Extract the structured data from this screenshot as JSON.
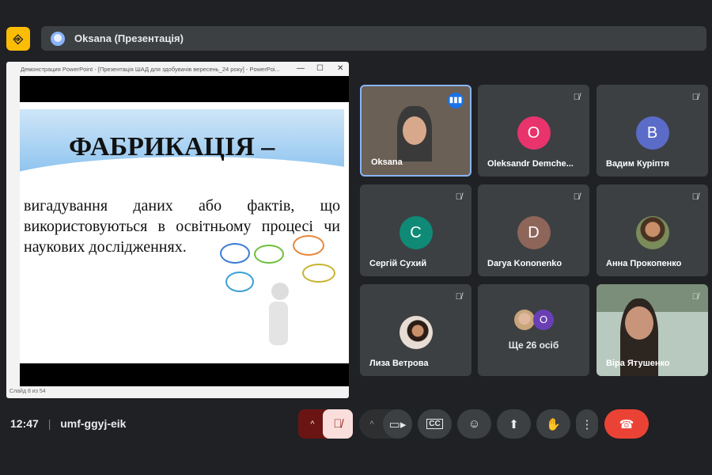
{
  "app_icon": "exit-icon",
  "top_bar": {
    "presenter": "Oksana (Презентація)"
  },
  "presentation": {
    "window_title": "Демонстрация PowerPoint - [Презентація ШАД для здобувачів вересень_24 року] - PowerPoi...",
    "slide_title": "ФАБРИКАЦІЯ –",
    "slide_text": "вигадування даних або фактів, що використовуються в освітньому процесі чи наукових дослідженнях.",
    "status": "Слайд 8 из 54"
  },
  "participants": [
    {
      "name": "Oksana",
      "type": "video",
      "speaking": true
    },
    {
      "name": "Oleksandr Demche...",
      "initial": "O",
      "color": "#e8336d",
      "muted": true
    },
    {
      "name": "Вадим Курiптя",
      "initial": "B",
      "color": "#5b6bc8",
      "muted": true
    },
    {
      "name": "Сергій Сухий",
      "initial": "C",
      "color": "#0f8a76",
      "muted": true
    },
    {
      "name": "Darya Kononenko",
      "initial": "D",
      "color": "#8d6659",
      "muted": true
    },
    {
      "name": "Анна Прокопенко",
      "type": "photo",
      "muted": true
    },
    {
      "name": "Лиза Ветрова",
      "type": "photo",
      "muted": true
    },
    {
      "name": "Ще 26 осіб",
      "type": "more",
      "initial": "O",
      "color": "#6a3fb5"
    },
    {
      "name": "Віра Ятушенко",
      "type": "video",
      "muted": true
    }
  ],
  "bottom": {
    "time": "12:47",
    "meeting_code": "umf-ggyj-eik"
  },
  "colors": {
    "accent": "#8ab4f8",
    "end_call": "#ea4335",
    "mic_off_bg": "#f9dedc"
  }
}
